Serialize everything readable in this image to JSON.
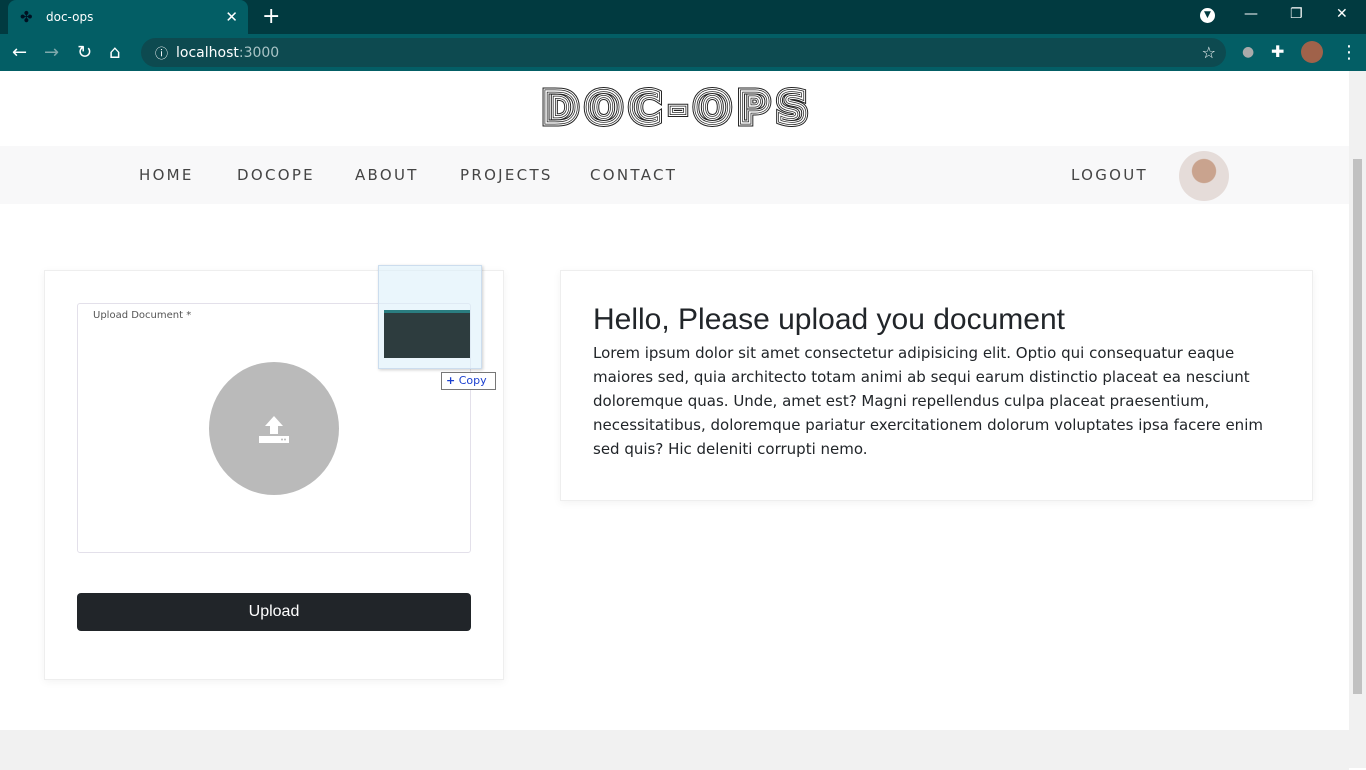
{
  "browser": {
    "tab_title": "doc-ops",
    "url_host": "localhost",
    "url_port": ":3000"
  },
  "header": {
    "logo": "Doc-Ops"
  },
  "nav": {
    "items": [
      "HOME",
      "DOCOPE",
      "ABOUT",
      "PROJECTS",
      "CONTACT"
    ],
    "logout": "LOGOUT"
  },
  "upload": {
    "label": "Upload Document *",
    "button": "Upload",
    "drag_badge": "Copy"
  },
  "info": {
    "title": "Hello, Please upload you document",
    "body": "Lorem ipsum dolor sit amet consectetur adipisicing elit. Optio qui consequatur eaque maiores sed, quia architecto totam animi ab sequi earum distinctio placeat ea nesciunt doloremque quas. Unde, amet est? Magni repellendus culpa placeat praesentium, necessitatibus, doloremque pariatur exercitationem dolorum voluptates ipsa facere enim sed quis? Hic deleniti corrupti nemo."
  }
}
